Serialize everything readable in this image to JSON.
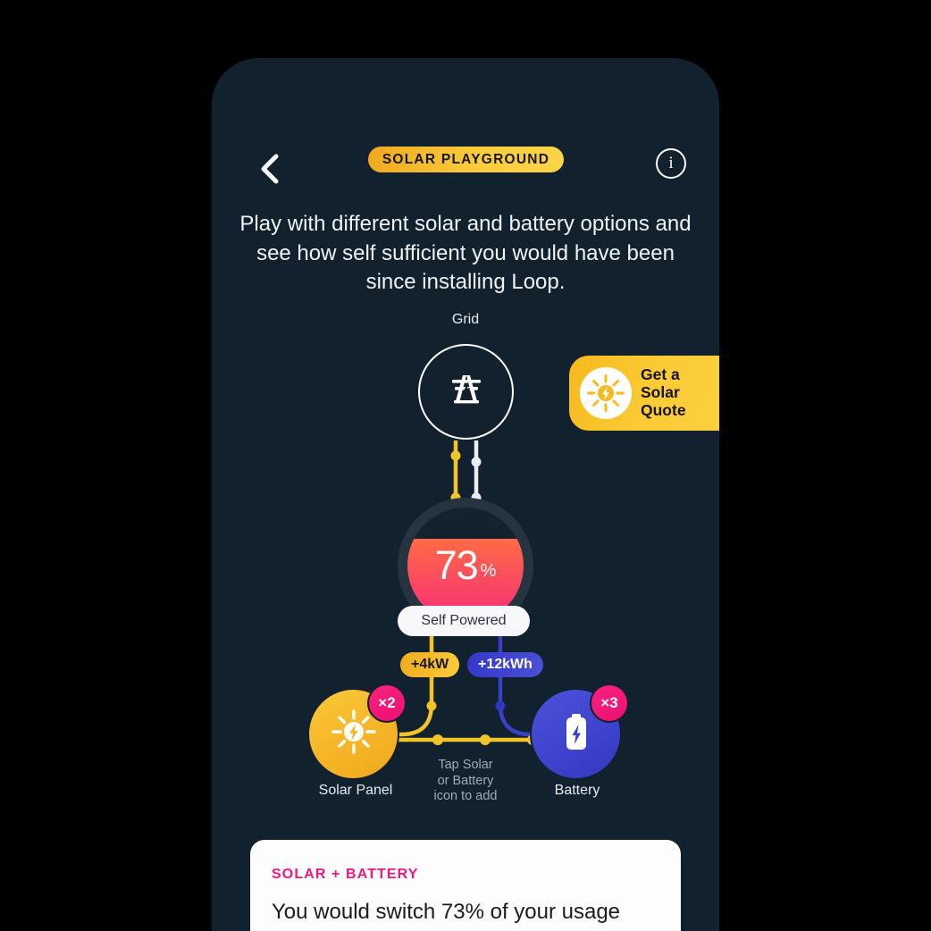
{
  "app": {
    "background_color": "#000000",
    "screen_color": "#11212d"
  },
  "header": {
    "back_icon": "chevron-left-icon",
    "title": "SOLAR PLAYGROUND",
    "title_pill_color": "#fbcd3c",
    "info_icon": "info-icon",
    "info_glyph": "i"
  },
  "intro": {
    "text": "Play with different solar and battery options and see how self sufficient you would have been since installing Loop."
  },
  "diagram": {
    "grid": {
      "label": "Grid",
      "icon": "power-pylon-icon"
    },
    "dial": {
      "value": 73,
      "value_text": "73",
      "unit": "%",
      "caption": "Self Powered",
      "fill_percent": 73,
      "gradient_top": "#fd6b45",
      "gradient_bottom": "#fa2a74",
      "ring_color": "#263440"
    },
    "solar": {
      "label": "Solar Panel",
      "icon": "sun-bolt-icon",
      "count_badge": "×2",
      "pill_value": "+4kW",
      "pill_color": "#fbcc3b",
      "node_color": "#f5b426"
    },
    "battery": {
      "label": "Battery",
      "icon": "battery-bolt-icon",
      "count_badge": "×3",
      "pill_value": "+12kWh",
      "pill_color": "#3b40ca",
      "node_color": "#3b40ca"
    },
    "hint": {
      "line1": "Tap Solar",
      "line2": "or Battery",
      "line3": "icon to add"
    },
    "badge_color": "#ec0f74"
  },
  "quote_badge": {
    "line1": "Get a",
    "line2": "Solar",
    "line3": "Quote",
    "icon": "sun-bolt-icon",
    "background_color": "#fbcb36"
  },
  "bottom_card": {
    "kicker": "SOLAR + BATTERY",
    "kicker_color": "#f4187e",
    "body": "You would switch 73% of your usage"
  }
}
